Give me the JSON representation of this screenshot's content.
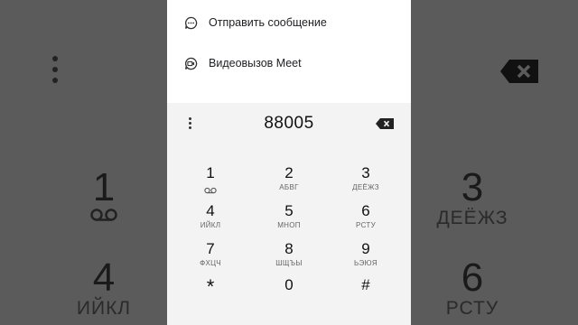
{
  "menu": {
    "items": [
      {
        "label": "Отправить сообщение",
        "icon": "message-icon"
      },
      {
        "label": "Видеовызов Meet",
        "icon": "video-call-icon"
      }
    ]
  },
  "dialer": {
    "number": "88005",
    "keys": [
      {
        "digit": "1",
        "letters": ""
      },
      {
        "digit": "2",
        "letters": "АБВГ"
      },
      {
        "digit": "3",
        "letters": "ДЕЁЖЗ"
      },
      {
        "digit": "4",
        "letters": "ИЙКЛ"
      },
      {
        "digit": "5",
        "letters": "МНОП"
      },
      {
        "digit": "6",
        "letters": "РСТУ"
      },
      {
        "digit": "7",
        "letters": "ФХЦЧ"
      },
      {
        "digit": "8",
        "letters": "ШЩЪЫ"
      },
      {
        "digit": "9",
        "letters": "ЬЭЮЯ"
      },
      {
        "digit": "*",
        "letters": ""
      },
      {
        "digit": "0",
        "letters": ""
      },
      {
        "digit": "#",
        "letters": ""
      }
    ]
  },
  "background": {
    "keys": [
      {
        "digit": "1",
        "letters": ""
      },
      {
        "digit": "3",
        "letters": "ДЕЁЖЗ"
      },
      {
        "digit": "4",
        "letters": "ИЙКЛ"
      },
      {
        "digit": "6",
        "letters": "РСТУ"
      }
    ]
  },
  "colors": {
    "background": "#595959",
    "panel": "#ffffff",
    "dialer": "#f3f3f3"
  }
}
